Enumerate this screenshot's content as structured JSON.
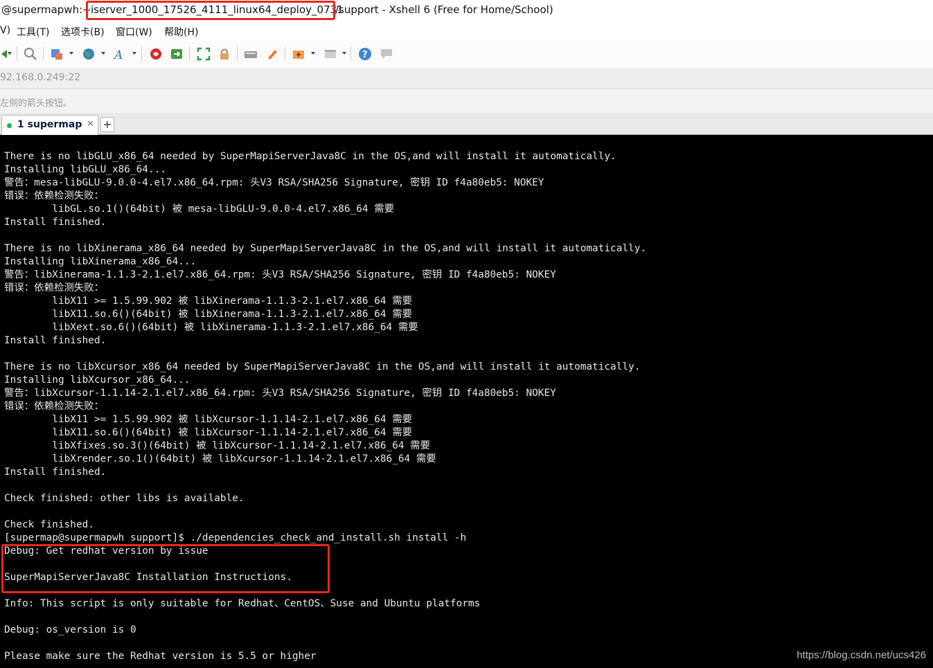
{
  "window": {
    "title_prefix": "@supermapwh:~",
    "title_highlight": "iserver_1000_17526_4111_linux64_deploy_0731",
    "title_suffix": "/support - Xshell 6 (Free for Home/School)"
  },
  "menu": {
    "items": [
      {
        "label": "V)"
      },
      {
        "label": "工具(T)"
      },
      {
        "label": "选项卡(B)"
      },
      {
        "label": "窗口(W)"
      },
      {
        "label": "帮助(H)"
      }
    ]
  },
  "toolbar": {
    "icons": [
      "new-session-icon",
      "search-icon",
      "properties-icon",
      "globe-icon",
      "font-icon",
      "xshell-logo-icon",
      "xftp-icon",
      "fullscreen-icon",
      "lock-icon",
      "keyboard-icon",
      "highlight-icon",
      "folder-add-icon",
      "layout-icon",
      "help-icon",
      "chat-icon"
    ]
  },
  "address": {
    "text": "92.168.0.249:22"
  },
  "hint": {
    "text": "左侧的箭头按钮。"
  },
  "tabs": [
    {
      "label": "1 supermap",
      "status_color": "#1fb53a"
    }
  ],
  "new_tab_label": "+",
  "terminal": {
    "lines": [
      "There is no libGLU_x86_64 needed by SuperMapiServerJava8C in the OS,and will install it automatically.",
      "Installing libGLU_x86_64...",
      "警告：mesa-libGLU-9.0.0-4.el7.x86_64.rpm: 头V3 RSA/SHA256 Signature, 密钥 ID f4a80eb5: NOKEY",
      "错误：依赖检测失败：",
      "        libGL.so.1()(64bit) 被 mesa-libGLU-9.0.0-4.el7.x86_64 需要",
      "Install finished.",
      "",
      "There is no libXinerama_x86_64 needed by SuperMapiServerJava8C in the OS,and will install it automatically.",
      "Installing libXinerama_x86_64...",
      "警告：libXinerama-1.1.3-2.1.el7.x86_64.rpm: 头V3 RSA/SHA256 Signature, 密钥 ID f4a80eb5: NOKEY",
      "错误：依赖检测失败：",
      "        libX11 >= 1.5.99.902 被 libXinerama-1.1.3-2.1.el7.x86_64 需要",
      "        libX11.so.6()(64bit) 被 libXinerama-1.1.3-2.1.el7.x86_64 需要",
      "        libXext.so.6()(64bit) 被 libXinerama-1.1.3-2.1.el7.x86_64 需要",
      "Install finished.",
      "",
      "There is no libXcursor_x86_64 needed by SuperMapiServerJava8C in the OS,and will install it automatically.",
      "Installing libXcursor_x86_64...",
      "警告：libXcursor-1.1.14-2.1.el7.x86_64.rpm: 头V3 RSA/SHA256 Signature, 密钥 ID f4a80eb5: NOKEY",
      "错误：依赖检测失败：",
      "        libX11 >= 1.5.99.902 被 libXcursor-1.1.14-2.1.el7.x86_64 需要",
      "        libX11.so.6()(64bit) 被 libXcursor-1.1.14-2.1.el7.x86_64 需要",
      "        libXfixes.so.3()(64bit) 被 libXcursor-1.1.14-2.1.el7.x86_64 需要",
      "        libXrender.so.1()(64bit) 被 libXcursor-1.1.14-2.1.el7.x86_64 需要",
      "Install finished.",
      "",
      "Check finished: other libs is available.",
      "",
      "Check finished.",
      "[supermap@supermapwh support]$ ./dependencies_check_and_install.sh install -h",
      "Debug: Get redhat version by issue",
      "",
      "SuperMapiServerJava8C Installation Instructions.",
      "",
      "Info: This script is only suitable for Redhat、CentOS、Suse and Ubuntu platforms",
      "",
      "Debug: os_version is 0",
      "",
      "Please make sure the Redhat version is 5.5 or higher"
    ]
  },
  "watermark": "https://blog.csdn.net/ucs426",
  "colors": {
    "highlight_border": "#e8281c",
    "terminal_bg": "#000000",
    "terminal_fg": "#e8e8e8"
  }
}
